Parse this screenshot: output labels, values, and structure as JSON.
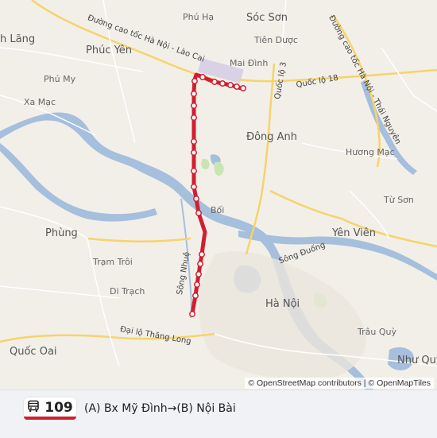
{
  "map": {
    "labels": [
      {
        "id": "lbl-phu-ha",
        "text": "Phú Hạ"
      },
      {
        "id": "lbl-soc-son",
        "text": "Sóc Sơn"
      },
      {
        "id": "lbl-h-lang",
        "text": "h Lãng"
      },
      {
        "id": "lbl-phuc-yen",
        "text": "Phúc Yên"
      },
      {
        "id": "lbl-tien-duoc",
        "text": "Tiên Dược"
      },
      {
        "id": "lbl-mai-dinh",
        "text": "Mai Đình"
      },
      {
        "id": "lbl-phu-my",
        "text": "Phú My"
      },
      {
        "id": "lbl-xa-mac",
        "text": "Xa Mạc"
      },
      {
        "id": "lbl-dong-anh",
        "text": "Đông Anh"
      },
      {
        "id": "lbl-huong-mac",
        "text": "Hương Mạc"
      },
      {
        "id": "lbl-tu-son",
        "text": "Từ Sơn"
      },
      {
        "id": "lbl-boi",
        "text": "Bối"
      },
      {
        "id": "lbl-phung",
        "text": "Phùng"
      },
      {
        "id": "lbl-yen-vien",
        "text": "Yên Viên"
      },
      {
        "id": "lbl-tram-troi",
        "text": "Trạm Trôi"
      },
      {
        "id": "lbl-song-duong",
        "text": "Sông Đuống"
      },
      {
        "id": "lbl-song-nhue",
        "text": "Sông Nhuệ"
      },
      {
        "id": "lbl-di-trach",
        "text": "Di Trạch"
      },
      {
        "id": "lbl-ha-noi",
        "text": "Hà Nội"
      },
      {
        "id": "lbl-dai-lo",
        "text": "Đại lộ Thăng Long"
      },
      {
        "id": "lbl-trau-quy",
        "text": "Trâu Quỳ"
      },
      {
        "id": "lbl-quoc-oai",
        "text": "Quốc Oai"
      },
      {
        "id": "lbl-nhu-quy",
        "text": "Như Quỳ"
      },
      {
        "id": "lbl-ql3",
        "text": "Quốc lộ 3"
      },
      {
        "id": "lbl-ql18",
        "text": "Quốc lộ 18"
      },
      {
        "id": "lbl-ct-hn-lc",
        "text": "Đường cao tốc Hà Nội - Lào Cai"
      },
      {
        "id": "lbl-ct-hn-tn",
        "text": "Đường cao tốc Hà Nội - Thái Nguyên"
      }
    ],
    "attribution": "© OpenStreetMap contributors | © OpenMapTiles",
    "route_color": "#d01f2f"
  },
  "route": {
    "number": "109",
    "name": "(A) Bx Mỹ Đình→(B) Nội Bài"
  }
}
